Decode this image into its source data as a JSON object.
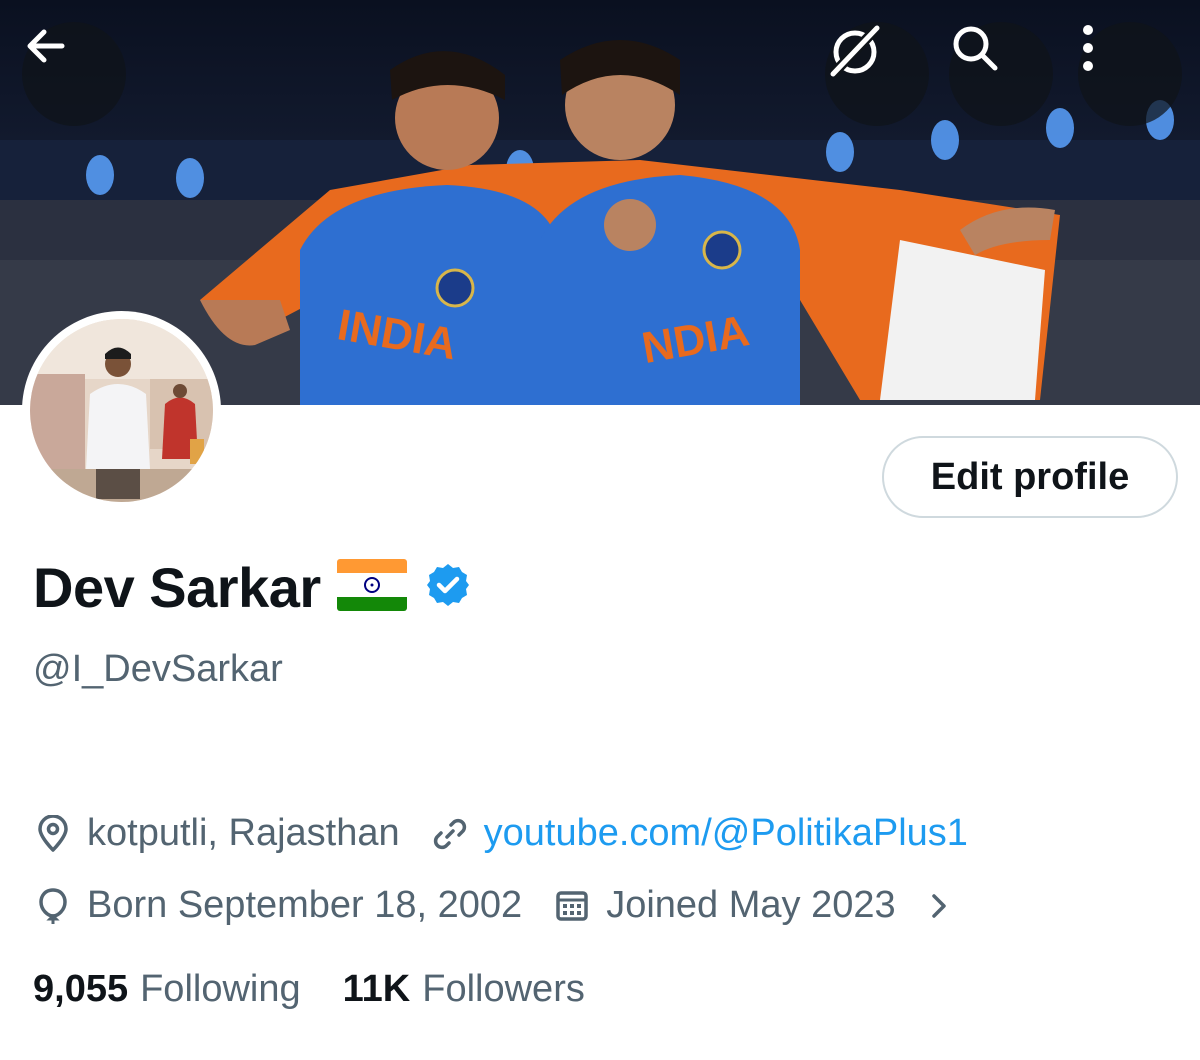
{
  "header": {
    "back_icon": "arrow-left-icon",
    "grok_icon": "grok-icon",
    "search_icon": "search-icon",
    "more_icon": "more-vertical-icon"
  },
  "banner": {
    "jersey_text_left": "INDIA",
    "jersey_text_right": "NDIA"
  },
  "profile": {
    "edit_button": "Edit profile",
    "display_name": "Dev Sarkar",
    "flag_icon": "india-flag-icon",
    "verified_icon": "verified-badge-icon",
    "verified_color": "#1d9bf0",
    "handle": "@I_DevSarkar",
    "location": "kotputli, Rajasthan",
    "website": "youtube.com/@PolitikaPlus1",
    "birthday": "Born September 18, 2002",
    "joined": "Joined May 2023",
    "following_count": "9,055",
    "following_label": "Following",
    "followers_count": "11K",
    "followers_label": "Followers"
  },
  "colors": {
    "link": "#1d9bf0",
    "secondary_text": "#536471",
    "primary_text": "#0f1419"
  }
}
